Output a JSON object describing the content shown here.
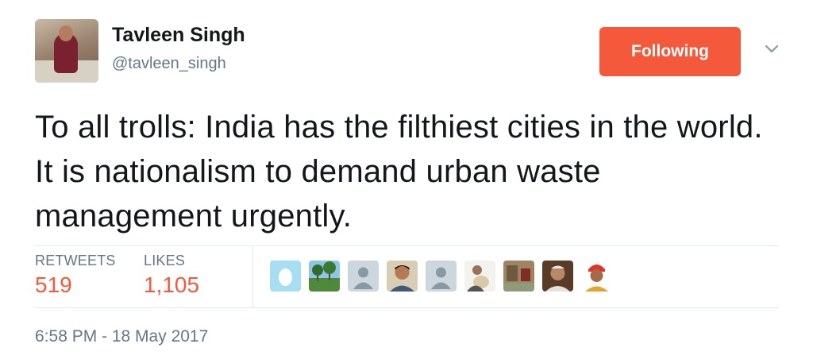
{
  "author": {
    "name": "Tavleen Singh",
    "handle": "@tavleen_singh"
  },
  "follow_button": {
    "label": "Following",
    "color": "#f4593b"
  },
  "tweet": {
    "text": "To all trolls: India has the filthiest cities in the world. It is nationalism to demand urban waste management urgently."
  },
  "stats": {
    "retweets_label": "RETWEETS",
    "retweets_value": "519",
    "likes_label": "LIKES",
    "likes_value": "1,105",
    "accent_color": "#f4593b"
  },
  "liker_avatars": [
    {
      "icon": "egg-default-avatar-icon"
    },
    {
      "icon": "palm-trees-photo-avatar"
    },
    {
      "icon": "default-person-avatar-icon"
    },
    {
      "icon": "man-photo-avatar"
    },
    {
      "icon": "default-person-avatar-icon"
    },
    {
      "icon": "person-with-dog-photo-avatar"
    },
    {
      "icon": "street-scene-photo-avatar"
    },
    {
      "icon": "elderly-man-photo-avatar"
    },
    {
      "icon": "man-in-turban-photo-avatar"
    }
  ],
  "timestamp": "6:58 PM - 18 May 2017"
}
